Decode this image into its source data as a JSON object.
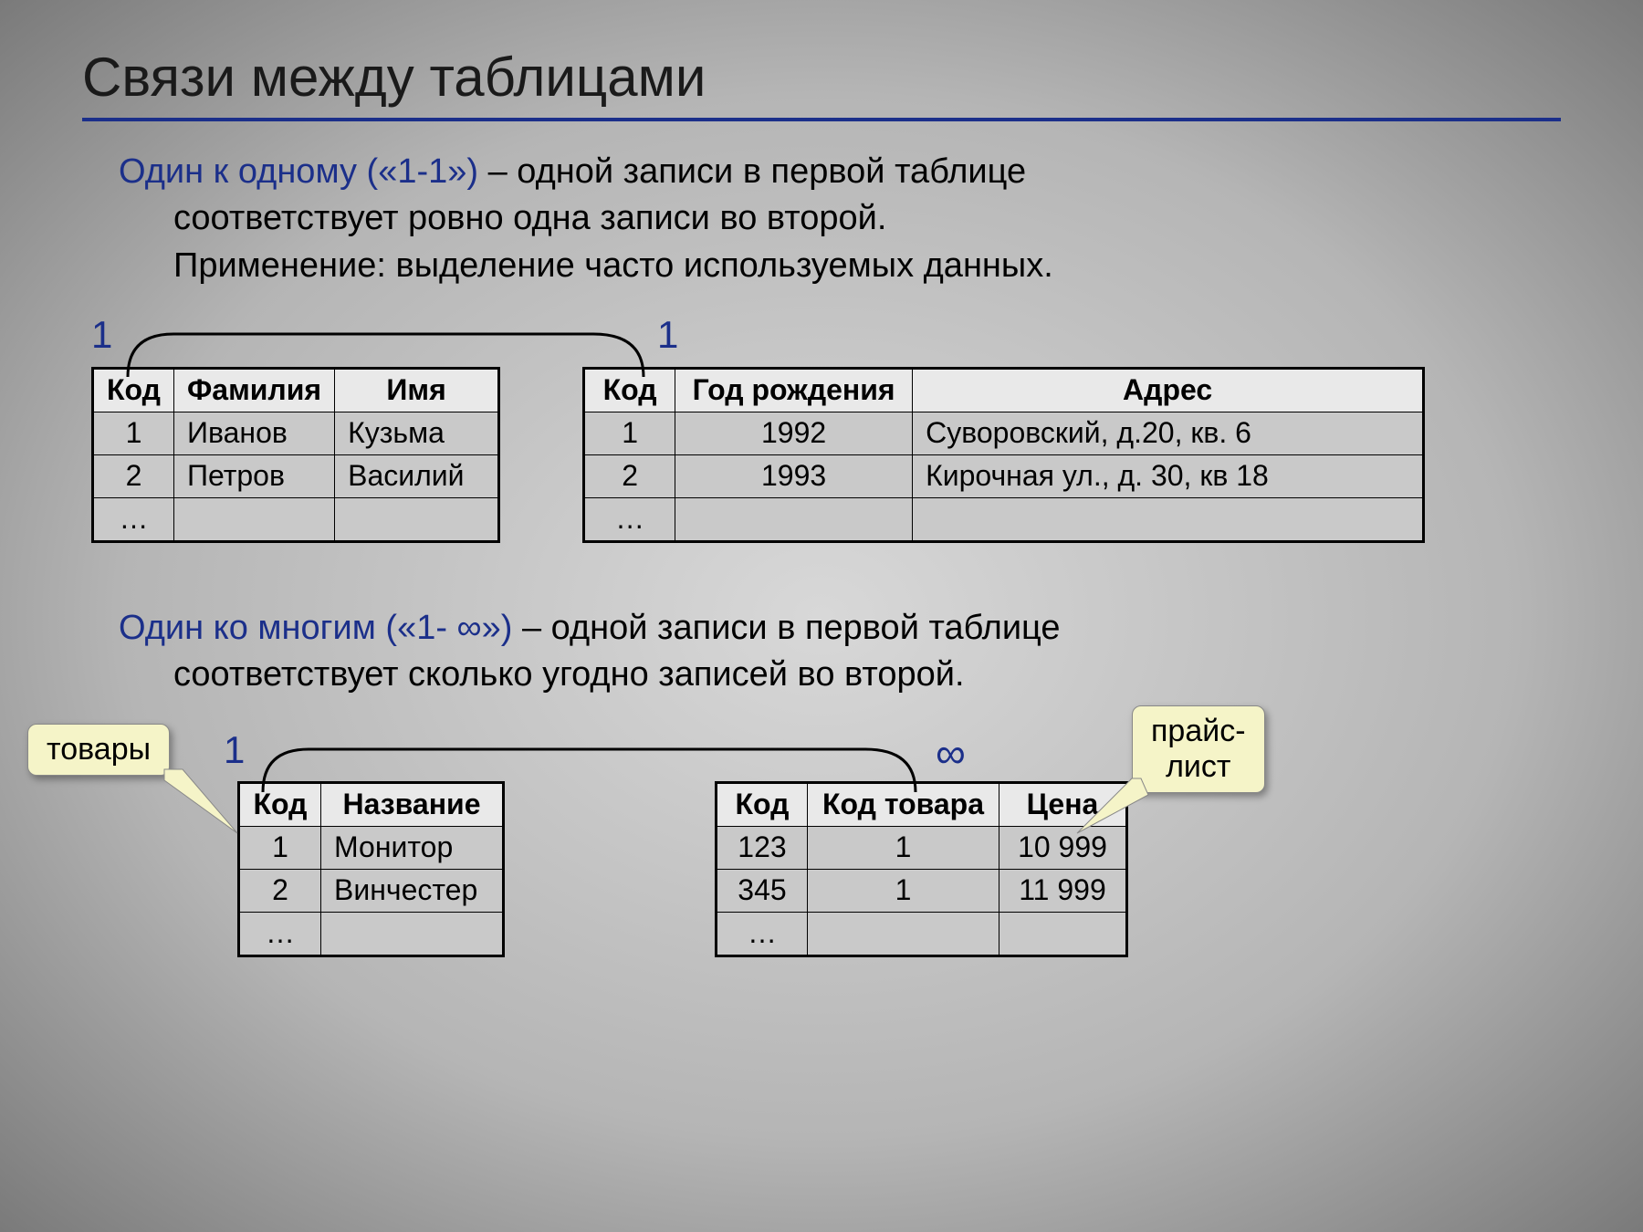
{
  "title": "Связи между таблицами",
  "one_to_one": {
    "heading_blue": "Один к одному («1-1»)",
    "heading_rest": " – одной записи в первой таблице",
    "line2": "соответствует ровно одна записи во второй.",
    "line3": "Применение: выделение часто используемых данных.",
    "left_card": "1",
    "right_card": "1",
    "table_left": {
      "headers": [
        "Код",
        "Фамилия",
        "Имя"
      ],
      "rows": [
        [
          "1",
          "Иванов",
          "Кузьма"
        ],
        [
          "2",
          "Петров",
          "Василий"
        ],
        [
          "…",
          "",
          ""
        ]
      ]
    },
    "table_right": {
      "headers": [
        "Код",
        "Год рождения",
        "Адрес"
      ],
      "rows": [
        [
          "1",
          "1992",
          "Суворовский, д.20, кв. 6"
        ],
        [
          "2",
          "1993",
          "Кирочная ул., д. 30, кв 18"
        ],
        [
          "…",
          "",
          ""
        ]
      ]
    }
  },
  "one_to_many": {
    "heading_blue": "Один ко многим («1- ∞»)",
    "heading_rest": " – одной записи в первой таблице",
    "line2": "соответствует сколько угодно записей во второй.",
    "left_card": "1",
    "right_card": "∞",
    "callout_left": "товары",
    "callout_right": "прайс-\nлист",
    "table_left": {
      "headers": [
        "Код",
        "Название"
      ],
      "rows": [
        [
          "1",
          "Монитор"
        ],
        [
          "2",
          "Винчестер"
        ],
        [
          "…",
          ""
        ]
      ]
    },
    "table_right": {
      "headers": [
        "Код",
        "Код товара",
        "Цена"
      ],
      "rows": [
        [
          "123",
          "1",
          "10 999"
        ],
        [
          "345",
          "1",
          "11 999"
        ],
        [
          "…",
          "",
          ""
        ]
      ]
    }
  }
}
